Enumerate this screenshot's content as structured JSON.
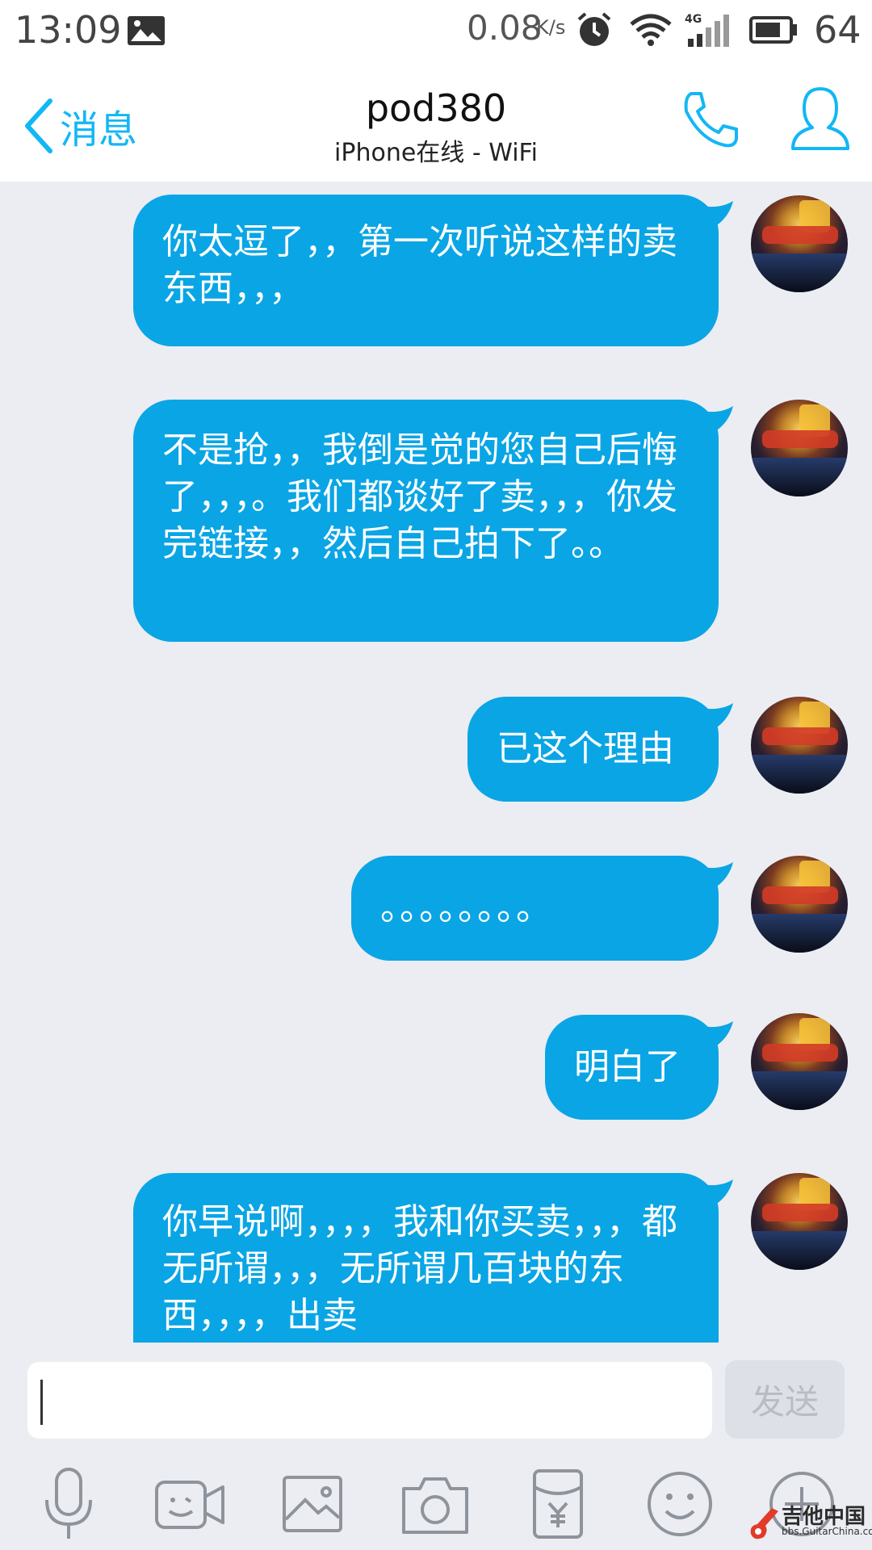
{
  "status_bar": {
    "time": "13:09",
    "speed": "0.08",
    "speed_unit": "K/s",
    "network": "4G",
    "battery": "64"
  },
  "header": {
    "back_label": "消息",
    "contact_name": "pod380",
    "contact_status": "iPhone在线 - WiFi"
  },
  "messages": [
    {
      "text": "你太逗了，，第一次听说这样的卖东西，，，"
    },
    {
      "text": "不是抢，，我倒是觉的您自己后悔了，，，。我们都谈好了卖，，，你发完链接，，然后自己拍下了。。"
    },
    {
      "text": "已这个理由"
    },
    {
      "text": "。。。。。。。。"
    },
    {
      "text": "明白了"
    },
    {
      "text": "你早说啊，，，，我和你买卖，，，都无所谓，，，无所谓几百块的东西，，，，出卖"
    }
  ],
  "input": {
    "value": "",
    "send_label": "发送"
  },
  "toolbar": {
    "icons": [
      "microphone-icon",
      "video-call-icon",
      "image-icon",
      "camera-icon",
      "red-packet-icon",
      "emoji-icon",
      "plus-icon"
    ]
  },
  "watermark": {
    "title": "吉他中国",
    "subtitle": "bbs.GuitarChina.com"
  },
  "colors": {
    "accent": "#12b7f5",
    "bubble": "#0aa5e5",
    "background": "#ebedf2"
  }
}
